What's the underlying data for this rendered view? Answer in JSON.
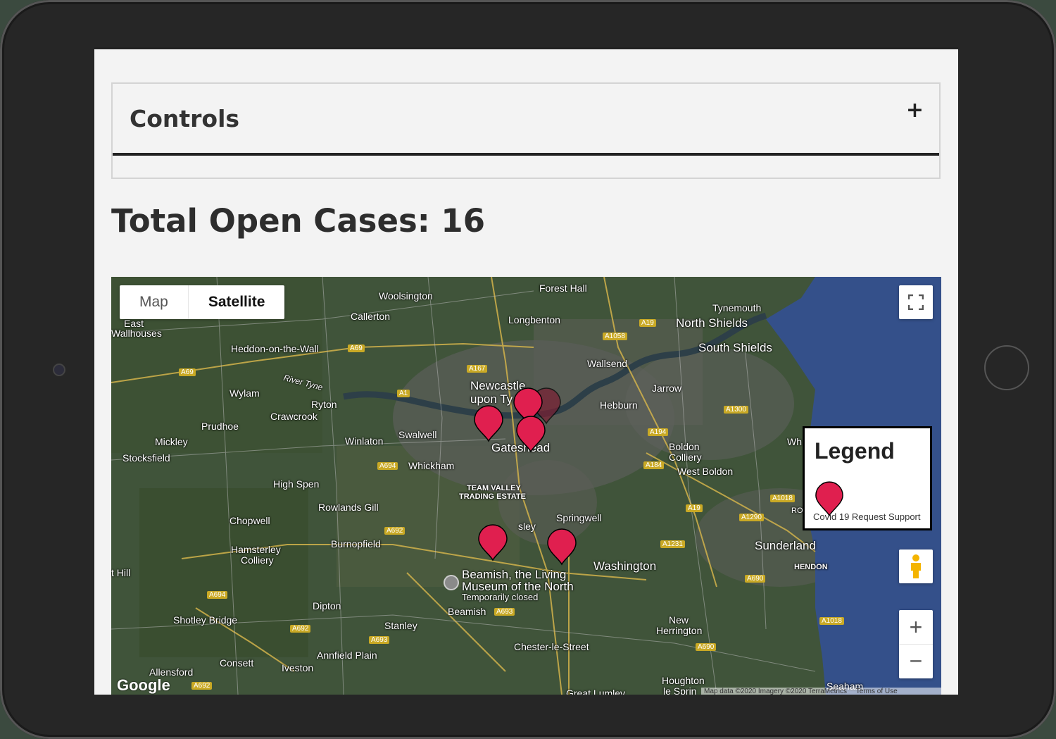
{
  "controls": {
    "title": "Controls",
    "toggle": "+"
  },
  "summary": {
    "label": "Total Open Cases: 16"
  },
  "map": {
    "type_buttons": {
      "map": "Map",
      "satellite": "Satellite"
    },
    "zoom_in": "+",
    "zoom_out": "−",
    "google": "Google",
    "attribution": "Map data ©2020 Imagery ©2020 TerraMetrics",
    "terms": "Terms of Use",
    "places": {
      "forest_hall": "Forest Hall",
      "woolsington": "Woolsington",
      "callerton": "Callerton",
      "tynemouth": "Tynemouth",
      "north_shields": "North Shields",
      "longbenton": "Longbenton",
      "east_wallhouses": "East",
      "wallhouses": "Wallhouses",
      "heddon": "Heddon-on-the-Wall",
      "south_shields": "South Shields",
      "wallsend": "Wallsend",
      "newcastle": "Newcastle",
      "upon_tyne": "upon Ty",
      "jarrow": "Jarrow",
      "wylam": "Wylam",
      "river_tyne": "River Tyne",
      "ryton": "Ryton",
      "hebburn": "Hebburn",
      "crawcrook": "Crawcrook",
      "prudhoe": "Prudhoe",
      "swalwell": "Swalwell",
      "winlaton": "Winlaton",
      "gateshead": "Gateshead",
      "boldon_colliery": "Boldon Colliery",
      "boldon_1": "Boldon",
      "boldon_2": "Colliery",
      "west_boldon": "West Boldon",
      "mickley": "Mickley",
      "stocksfield": "Stocksfield",
      "whickham": "Whickham",
      "high_spen": "High Spen",
      "team_valley_1": "TEAM VALLEY",
      "team_valley_2": "TRADING ESTATE",
      "rowlands_gill": "Rowlands Gill",
      "chopwell": "Chopwell",
      "springwell": "Springwell",
      "hamsterley_1": "Hamsterley",
      "hamsterley_2": "Colliery",
      "burnopfield": "Burnopfield",
      "sunderland": "Sunderland",
      "washington": "Washington",
      "hendon": "HENDON",
      "thill": "t Hill",
      "beamish_1": "Beamish, the Living",
      "beamish_2": "Museum of the North",
      "beamish_3": "Temporarily closed",
      "beamish": "Beamish",
      "dipton": "Dipton",
      "shotley_bridge": "Shotley Bridge",
      "stanley": "Stanley",
      "new_herrington_1": "New",
      "new_herrington_2": "Herrington",
      "chester_le_street": "Chester-le-Street",
      "annfield_plain": "Annfield Plain",
      "consett": "Consett",
      "iveston": "Iveston",
      "allensford": "Allensford",
      "houghton_1": "Houghton",
      "houghton_2": "le Sprin",
      "great_lumley": "Great Lumley",
      "seaham": "Seaham",
      "whi": "Wh",
      "ro": "RO",
      "sley": "sley"
    },
    "roads": [
      "A69",
      "A1058",
      "A19",
      "A69",
      "A167",
      "A1",
      "A1300",
      "A194",
      "A184",
      "A694",
      "A692",
      "A19",
      "A1018",
      "A1290",
      "A1231",
      "A690",
      "A694",
      "A692",
      "A693",
      "A693",
      "A1018",
      "A690",
      "A692"
    ]
  },
  "legend": {
    "title": "Legend",
    "item": "Covid 19 Request Support"
  },
  "colors": {
    "marker": "#e01f4f",
    "screen_bg": "#f3f3f3",
    "text": "#2d2d2d"
  }
}
